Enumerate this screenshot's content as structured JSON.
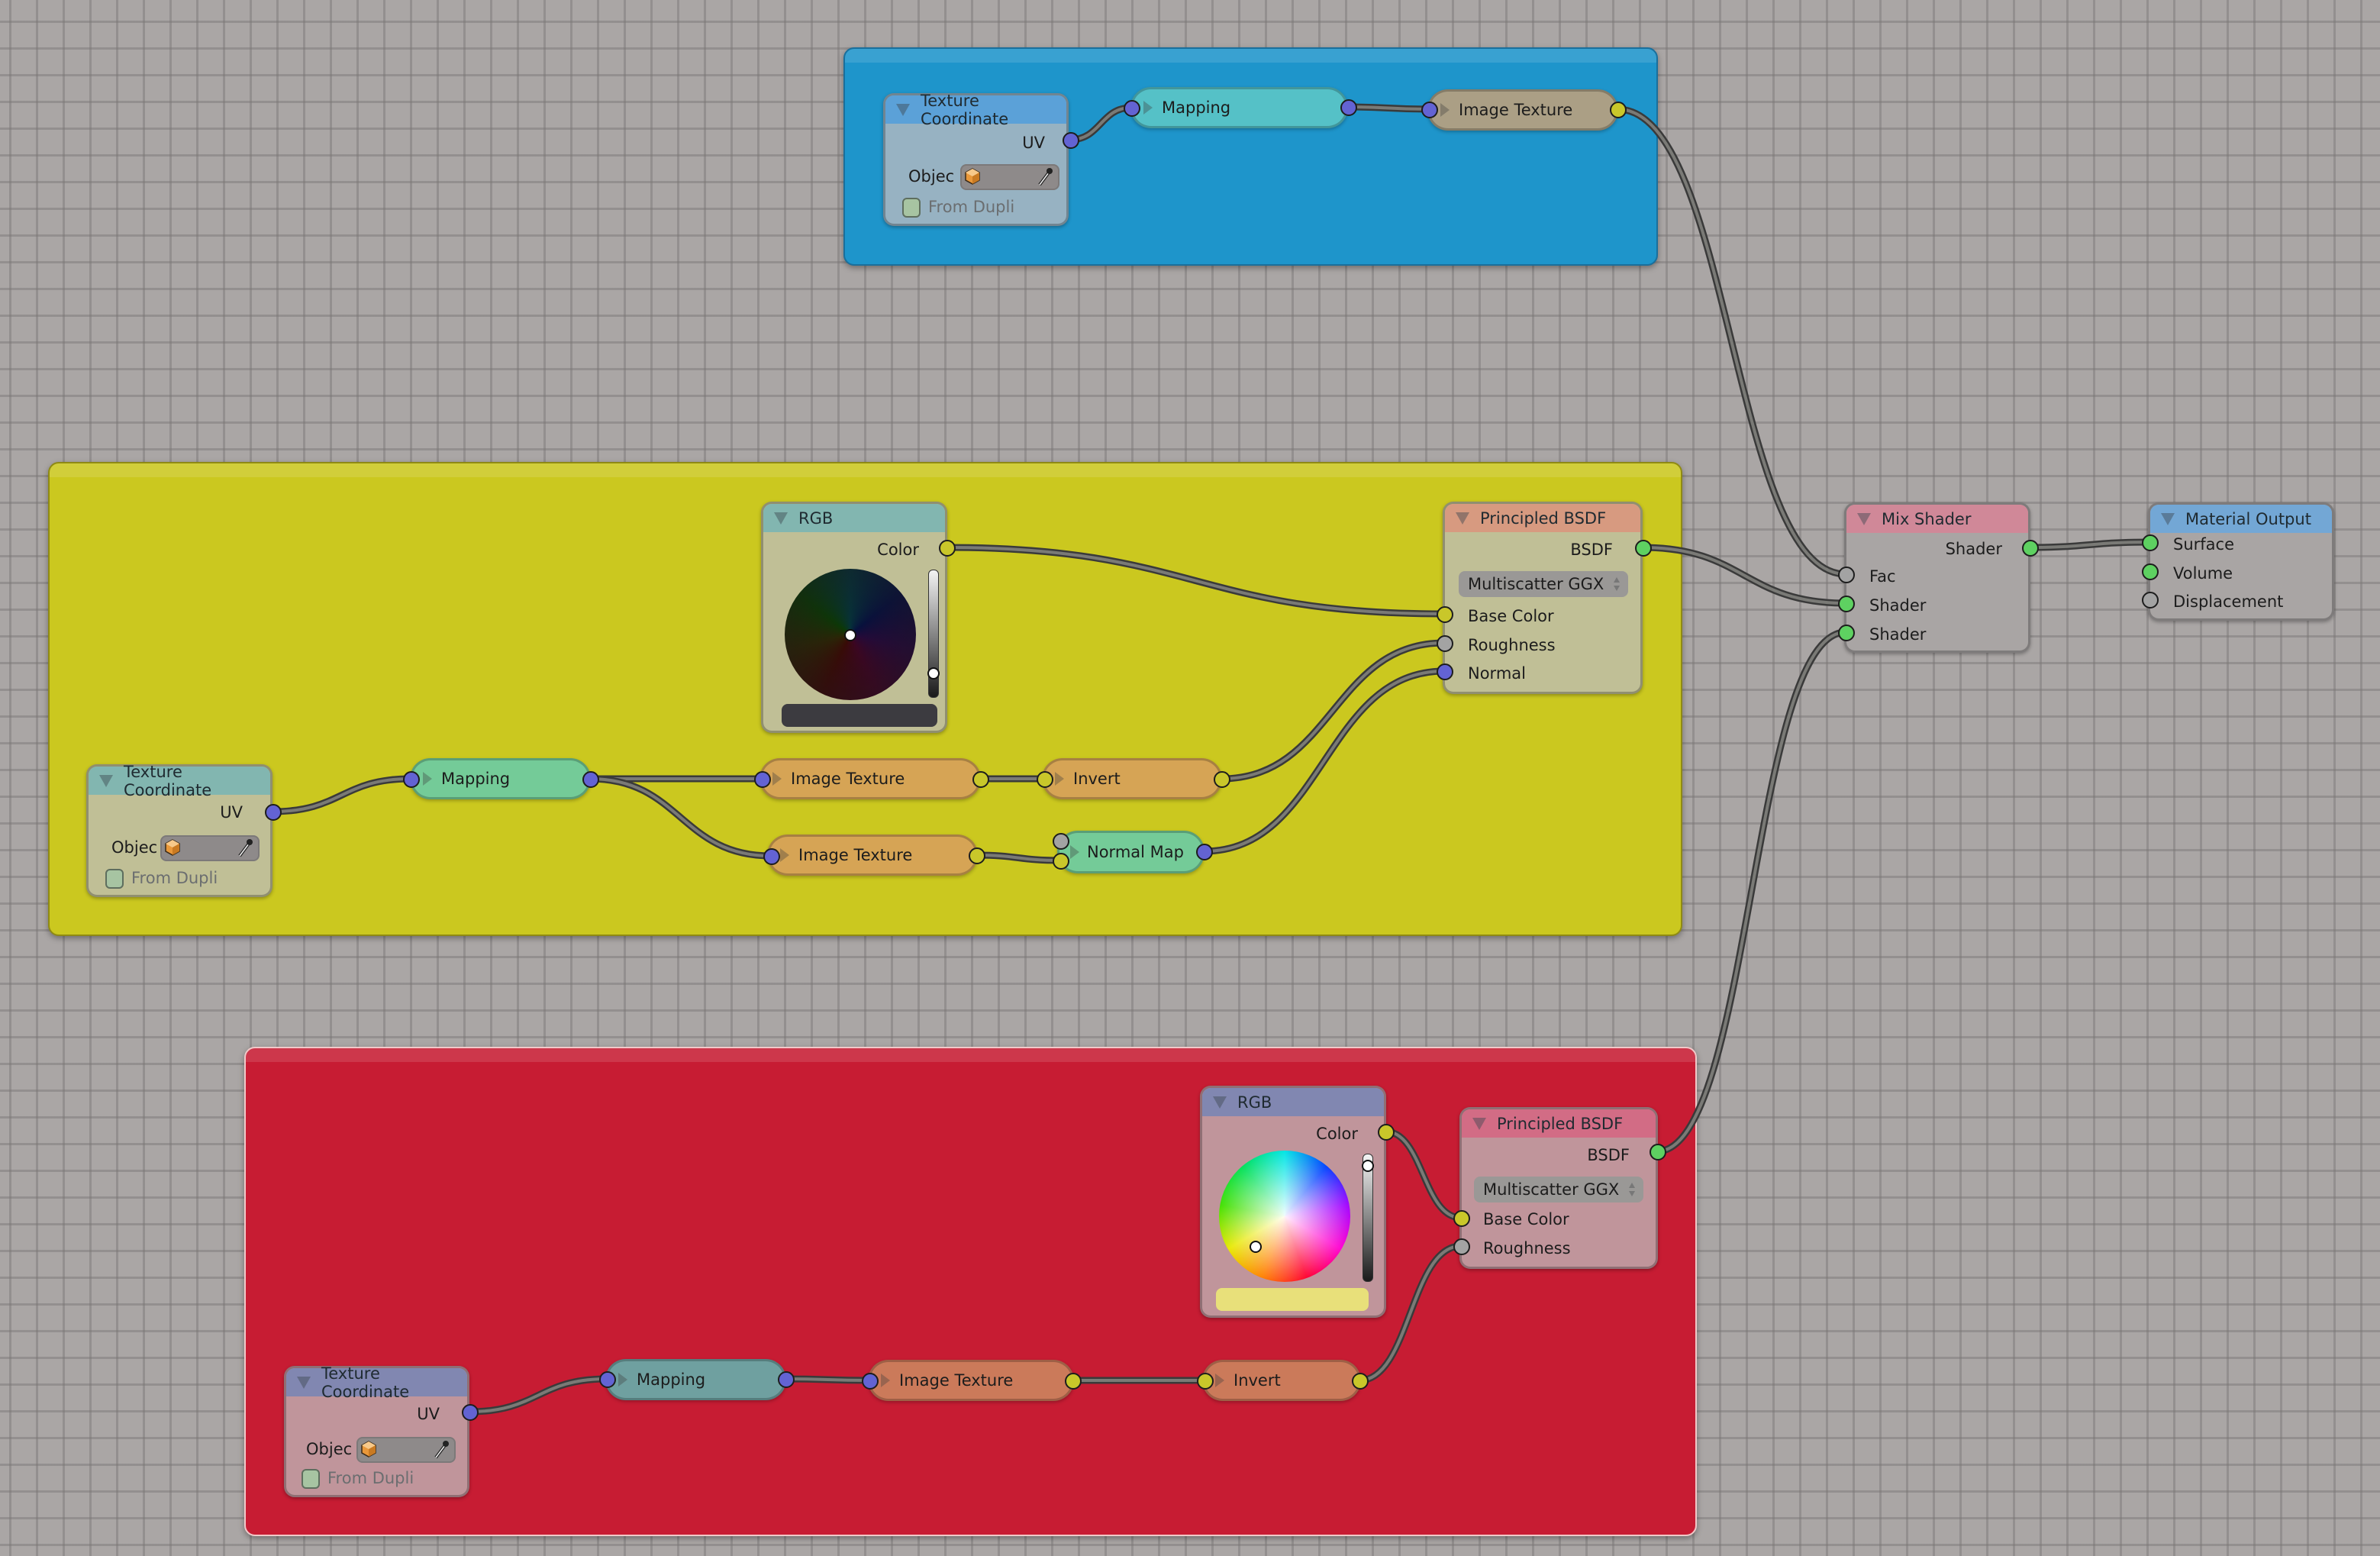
{
  "editor": "Node Editor",
  "colors": {
    "background": "#aaa6a5",
    "frame_blue": "#1e95cb",
    "frame_yellow": "#cbc81f",
    "frame_red": "#c71c33",
    "socket_vector": "#6363d3",
    "socket_color": "#c9c72a",
    "socket_shader": "#5ed161",
    "socket_value": "#a3a3a3"
  },
  "frames": {
    "blue": {
      "texture_coordinate": {
        "title": "Texture Coordinate",
        "output_uv": "UV",
        "object_label": "Objec",
        "from_dupli_label": "From Dupli",
        "from_dupli_checked": false
      },
      "mapping": {
        "title": "Mapping"
      },
      "image_texture": {
        "title": "Image Texture"
      }
    },
    "yellow": {
      "rgb": {
        "title": "RGB",
        "output_color": "Color",
        "color_value": "#3c3b40",
        "value_slider": 0.22
      },
      "principled": {
        "title": "Principled BSDF",
        "output": "BSDF",
        "distribution": "Multiscatter GGX",
        "inputs": [
          "Base Color",
          "Roughness",
          "Normal"
        ]
      },
      "texture_coordinate": {
        "title": "Texture Coordinate",
        "output_uv": "UV",
        "object_label": "Objec",
        "from_dupli_label": "From Dupli",
        "from_dupli_checked": false
      },
      "mapping": {
        "title": "Mapping"
      },
      "image_texture_1": {
        "title": "Image Texture"
      },
      "invert": {
        "title": "Invert"
      },
      "image_texture_2": {
        "title": "Image Texture"
      },
      "normal_map": {
        "title": "Normal Map"
      }
    },
    "red": {
      "rgb": {
        "title": "RGB",
        "output_color": "Color",
        "color_value": "#e8e07a",
        "value_slider": 0.95
      },
      "principled": {
        "title": "Principled BSDF",
        "output": "BSDF",
        "distribution": "Multiscatter GGX",
        "inputs": [
          "Base Color",
          "Roughness"
        ]
      },
      "texture_coordinate": {
        "title": "Texture Coordinate",
        "output_uv": "UV",
        "object_label": "Objec",
        "from_dupli_label": "From Dupli",
        "from_dupli_checked": false
      },
      "mapping": {
        "title": "Mapping"
      },
      "image_texture": {
        "title": "Image Texture"
      },
      "invert": {
        "title": "Invert"
      }
    }
  },
  "mix_shader": {
    "title": "Mix Shader",
    "output": "Shader",
    "inputs": [
      "Fac",
      "Shader",
      "Shader"
    ]
  },
  "material_output": {
    "title": "Material Output",
    "inputs": [
      "Surface",
      "Volume",
      "Displacement"
    ]
  }
}
